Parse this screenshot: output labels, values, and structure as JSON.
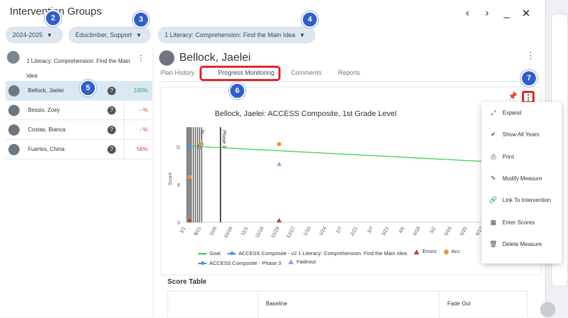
{
  "window": {
    "title": "Intervention Groups",
    "controls": [
      "‹",
      "›",
      "_",
      "✕"
    ]
  },
  "filters": {
    "year": "2024-2025",
    "school": "Educlimber, Support",
    "group": "1 Literacy: Comprehension: Find the Main Idea"
  },
  "markers": [
    "2",
    "3",
    "4",
    "5",
    "6",
    "7"
  ],
  "group": {
    "name": "1 Literacy: Comprehension: Find the Main Idea"
  },
  "students": [
    {
      "name": "Bellock, Jaelei",
      "pct": "100%",
      "pct_color": "#2ea44f"
    },
    {
      "name": "Bessix, Zoey",
      "pct": "--%",
      "pct_color": "#e03a3a"
    },
    {
      "name": "Costas, Bianca",
      "pct": "--%",
      "pct_color": "#e03a3a"
    },
    {
      "name": "Fuertes, China",
      "pct": "56%",
      "pct_color": "#e03a3a"
    }
  ],
  "student": {
    "name": "Bellock, Jaelei"
  },
  "tabs": [
    "Plan History",
    "Progress Monitoring",
    "Comments",
    "Reports"
  ],
  "chart_data": {
    "type": "line",
    "title": "Bellock, Jaelei: ACCESS Composite, 1st Grade Level",
    "ylabel": "Score",
    "y_ticks": [
      "0",
      "8",
      "D"
    ],
    "x_ticks": [
      "1/1",
      "9/21",
      "10/6",
      "10/16",
      "11/1",
      "11/16",
      "11/29",
      "12/27",
      "1/10",
      "1/24",
      "2/7",
      "2/21",
      "3/7",
      "3/21",
      "4/6",
      "4/18",
      "5/2",
      "5/16",
      "5/20",
      "6/13"
    ],
    "vertical_labels": [
      "Phase 3",
      "N...",
      "Phase 3"
    ],
    "series": [
      {
        "name": "Goal",
        "color": "#2ecc40",
        "points": [
          [
            "9/21",
            0.84
          ],
          [
            "6/13",
            0.67
          ]
        ]
      },
      {
        "name": "ACCESS Composite - v2 1 Literacy: Comprehension: Find the Main Idea",
        "color": "#4a90e2",
        "points": [
          [
            "9/21",
            0.84
          ]
        ]
      },
      {
        "name": "Errors",
        "color": "#c0392b",
        "points": [
          [
            "9/21",
            0.0
          ],
          [
            "11/29",
            0.0
          ]
        ]
      },
      {
        "name": "Acc...",
        "color": "#f0913a",
        "points": [
          [
            "9/21",
            0.86
          ],
          [
            "11/29",
            0.86
          ],
          [
            "1/1",
            0.5
          ]
        ]
      },
      {
        "name": "ACCESS Composite - Phase 3",
        "color": "#4a90e2",
        "points": [
          [
            "9/21",
            0.84
          ]
        ]
      },
      {
        "name": "Fadeout",
        "color": "#b38fdc",
        "points": [
          [
            "11/29",
            0.62
          ],
          [
            "9/21",
            0.8
          ]
        ]
      }
    ],
    "legend_position": "bottom"
  },
  "legend": [
    {
      "label": "Goal",
      "color": "#2ecc40",
      "sym": "line"
    },
    {
      "label": "ACCESS Composite - v2 1 Literacy: Comprehension: Find the Main Idea",
      "color": "#4a90e2",
      "sym": "dotline"
    },
    {
      "label": "Errors",
      "color": "#c0392b",
      "sym": "tri"
    },
    {
      "label": "Acc",
      "color": "#f0913a",
      "sym": "dot"
    },
    {
      "label": "ACCESS Composite - Phase 3",
      "color": "#4a90e2",
      "sym": "dotline"
    },
    {
      "label": "Fadeout",
      "color": "#b38fdc",
      "sym": "tri"
    }
  ],
  "score_table": {
    "title": "Score Table",
    "headers": [
      "",
      "Baseline",
      "Fade Out"
    ]
  },
  "menu": [
    {
      "label": "Expand",
      "icon": "expand-icon",
      "glyph": "⤢"
    },
    {
      "label": "Show All Years",
      "icon": "check-all-icon",
      "glyph": "✔"
    },
    {
      "label": "Print",
      "icon": "print-icon",
      "glyph": "⎙"
    },
    {
      "label": "Modify Measure",
      "icon": "edit-icon",
      "glyph": "✎"
    },
    {
      "label": "Link To Intervention",
      "icon": "link-icon",
      "glyph": "🔗"
    },
    {
      "label": "Enter Scores",
      "icon": "table-icon",
      "glyph": "▦"
    },
    {
      "label": "Delete Measure",
      "icon": "trash-icon",
      "glyph": "🗑"
    }
  ]
}
